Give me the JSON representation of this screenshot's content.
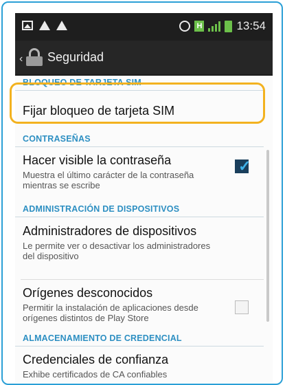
{
  "status_bar": {
    "time": "13:54",
    "network_type": "H",
    "icons_left": [
      "image-icon",
      "warning-icon",
      "warning-icon"
    ],
    "icons_right": [
      "nfc-icon",
      "h-network-icon",
      "signal-icon",
      "battery-icon"
    ]
  },
  "action_bar": {
    "title": "Seguridad",
    "icon": "lock-icon"
  },
  "sections": {
    "sim": {
      "header": "BLOQUEO DE TARJETA SIM",
      "item_title": "Fijar bloqueo de tarjeta SIM"
    },
    "passwords": {
      "header": "CONTRASEÑAS",
      "item_title": "Hacer visible la contraseña",
      "item_sub": "Muestra el último carácter de la contraseña mientras se escribe",
      "checked": true
    },
    "device_admin": {
      "header": "ADMINISTRACIÓN DE DISPOSITIVOS",
      "admins_title": "Administradores de dispositivos",
      "admins_sub": "Le permite ver o desactivar los administradores del dispositivo",
      "unknown_title": "Orígenes desconocidos",
      "unknown_sub": "Permitir la instalación de aplicaciones desde orígenes distintos de Play Store",
      "unknown_checked": false
    },
    "credentials": {
      "header": "ALMACENAMIENTO DE CREDENCIAL",
      "trusted_title": "Credenciales de confianza",
      "trusted_sub": "Exhibe certificados de CA confiables"
    }
  },
  "colors": {
    "accent": "#2d8fc2",
    "highlight": "#f3b21f",
    "frame": "#2a9fd6"
  }
}
